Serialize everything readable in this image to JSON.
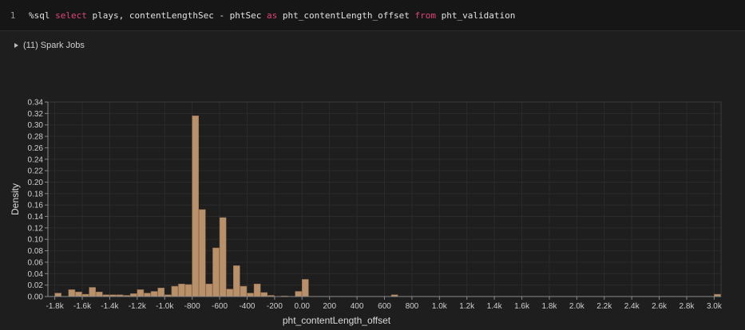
{
  "editor": {
    "line_number": "1",
    "tokens": [
      {
        "text": "%sql ",
        "kw": false
      },
      {
        "text": "select",
        "kw": true
      },
      {
        "text": " plays, contentLengthSec - phtSec ",
        "kw": false
      },
      {
        "text": "as",
        "kw": true
      },
      {
        "text": " pht_contentLength_offset ",
        "kw": false
      },
      {
        "text": "from",
        "kw": true
      },
      {
        "text": " pht_validation",
        "kw": false
      }
    ]
  },
  "spark_jobs": {
    "label": "(11) Spark Jobs"
  },
  "colors": {
    "bar": "#b8906a",
    "bar_edge": "#8f6a4b",
    "keyword": "#e0457b"
  },
  "chart_data": {
    "type": "bar",
    "xlabel": "pht_contentLength_offset",
    "ylabel": "Density",
    "xlim": [
      -1850,
      3050
    ],
    "ylim": [
      0,
      0.34
    ],
    "bin_width": 50,
    "x_ticks": [
      {
        "v": -1800,
        "label": "-1.8k"
      },
      {
        "v": -1600,
        "label": "-1.6k"
      },
      {
        "v": -1400,
        "label": "-1.4k"
      },
      {
        "v": -1200,
        "label": "-1.2k"
      },
      {
        "v": -1000,
        "label": "-1.0k"
      },
      {
        "v": -800,
        "label": "-800"
      },
      {
        "v": -600,
        "label": "-600"
      },
      {
        "v": -400,
        "label": "-400"
      },
      {
        "v": -200,
        "label": "-200"
      },
      {
        "v": 0,
        "label": "0.00"
      },
      {
        "v": 200,
        "label": "200"
      },
      {
        "v": 400,
        "label": "400"
      },
      {
        "v": 600,
        "label": "600"
      },
      {
        "v": 800,
        "label": "800"
      },
      {
        "v": 1000,
        "label": "1.0k"
      },
      {
        "v": 1200,
        "label": "1.2k"
      },
      {
        "v": 1400,
        "label": "1.4k"
      },
      {
        "v": 1600,
        "label": "1.6k"
      },
      {
        "v": 1800,
        "label": "1.8k"
      },
      {
        "v": 2000,
        "label": "2.0k"
      },
      {
        "v": 2200,
        "label": "2.2k"
      },
      {
        "v": 2400,
        "label": "2.4k"
      },
      {
        "v": 2600,
        "label": "2.6k"
      },
      {
        "v": 2800,
        "label": "2.8k"
      },
      {
        "v": 3000,
        "label": "3.0k"
      }
    ],
    "y_ticks": [
      {
        "v": 0,
        "label": "0.00"
      },
      {
        "v": 0.02,
        "label": "0.02"
      },
      {
        "v": 0.04,
        "label": "0.04"
      },
      {
        "v": 0.06,
        "label": "0.06"
      },
      {
        "v": 0.08,
        "label": "0.08"
      },
      {
        "v": 0.1,
        "label": "0.10"
      },
      {
        "v": 0.12,
        "label": "0.12"
      },
      {
        "v": 0.14,
        "label": "0.14"
      },
      {
        "v": 0.16,
        "label": "0.16"
      },
      {
        "v": 0.18,
        "label": "0.18"
      },
      {
        "v": 0.2,
        "label": "0.20"
      },
      {
        "v": 0.22,
        "label": "0.22"
      },
      {
        "v": 0.24,
        "label": "0.24"
      },
      {
        "v": 0.26,
        "label": "0.26"
      },
      {
        "v": 0.28,
        "label": "0.28"
      },
      {
        "v": 0.3,
        "label": "0.30"
      },
      {
        "v": 0.32,
        "label": "0.32"
      },
      {
        "v": 0.34,
        "label": "0.34"
      }
    ],
    "bins": [
      {
        "x": -1800,
        "y": 0.006
      },
      {
        "x": -1700,
        "y": 0.012
      },
      {
        "x": -1650,
        "y": 0.008
      },
      {
        "x": -1600,
        "y": 0.004
      },
      {
        "x": -1550,
        "y": 0.016
      },
      {
        "x": -1500,
        "y": 0.008
      },
      {
        "x": -1450,
        "y": 0.003
      },
      {
        "x": -1400,
        "y": 0.003
      },
      {
        "x": -1350,
        "y": 0.003
      },
      {
        "x": -1300,
        "y": 0.002
      },
      {
        "x": -1250,
        "y": 0.005
      },
      {
        "x": -1200,
        "y": 0.012
      },
      {
        "x": -1150,
        "y": 0.006
      },
      {
        "x": -1100,
        "y": 0.009
      },
      {
        "x": -1050,
        "y": 0.015
      },
      {
        "x": -1000,
        "y": 0.003
      },
      {
        "x": -950,
        "y": 0.018
      },
      {
        "x": -900,
        "y": 0.022
      },
      {
        "x": -850,
        "y": 0.021
      },
      {
        "x": -800,
        "y": 0.316
      },
      {
        "x": -750,
        "y": 0.152
      },
      {
        "x": -700,
        "y": 0.022
      },
      {
        "x": -650,
        "y": 0.085
      },
      {
        "x": -600,
        "y": 0.138
      },
      {
        "x": -550,
        "y": 0.013
      },
      {
        "x": -500,
        "y": 0.054
      },
      {
        "x": -450,
        "y": 0.018
      },
      {
        "x": -400,
        "y": 0.006
      },
      {
        "x": -350,
        "y": 0.022
      },
      {
        "x": -300,
        "y": 0.007
      },
      {
        "x": -250,
        "y": 0.002
      },
      {
        "x": -150,
        "y": 0.001
      },
      {
        "x": -50,
        "y": 0.009
      },
      {
        "x": 0,
        "y": 0.03
      },
      {
        "x": 650,
        "y": 0.003
      },
      {
        "x": 3000,
        "y": 0.004
      }
    ]
  }
}
